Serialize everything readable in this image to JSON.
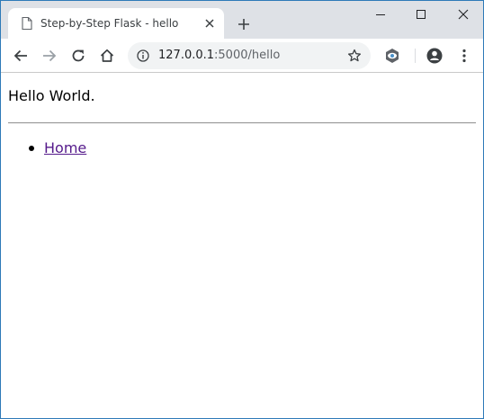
{
  "browser": {
    "tab": {
      "title": "Step-by-Step Flask - hello"
    },
    "address_bar": {
      "host": "127.0.0.1",
      "rest": ":5000/hello"
    }
  },
  "page": {
    "greeting": "Hello World.",
    "nav": [
      {
        "label": "Home"
      }
    ]
  },
  "colors": {
    "titlebar": "#dee1e6",
    "omnibox": "#f1f3f4",
    "visited_link": "#551a8b",
    "window_border": "#2e7ab8"
  }
}
